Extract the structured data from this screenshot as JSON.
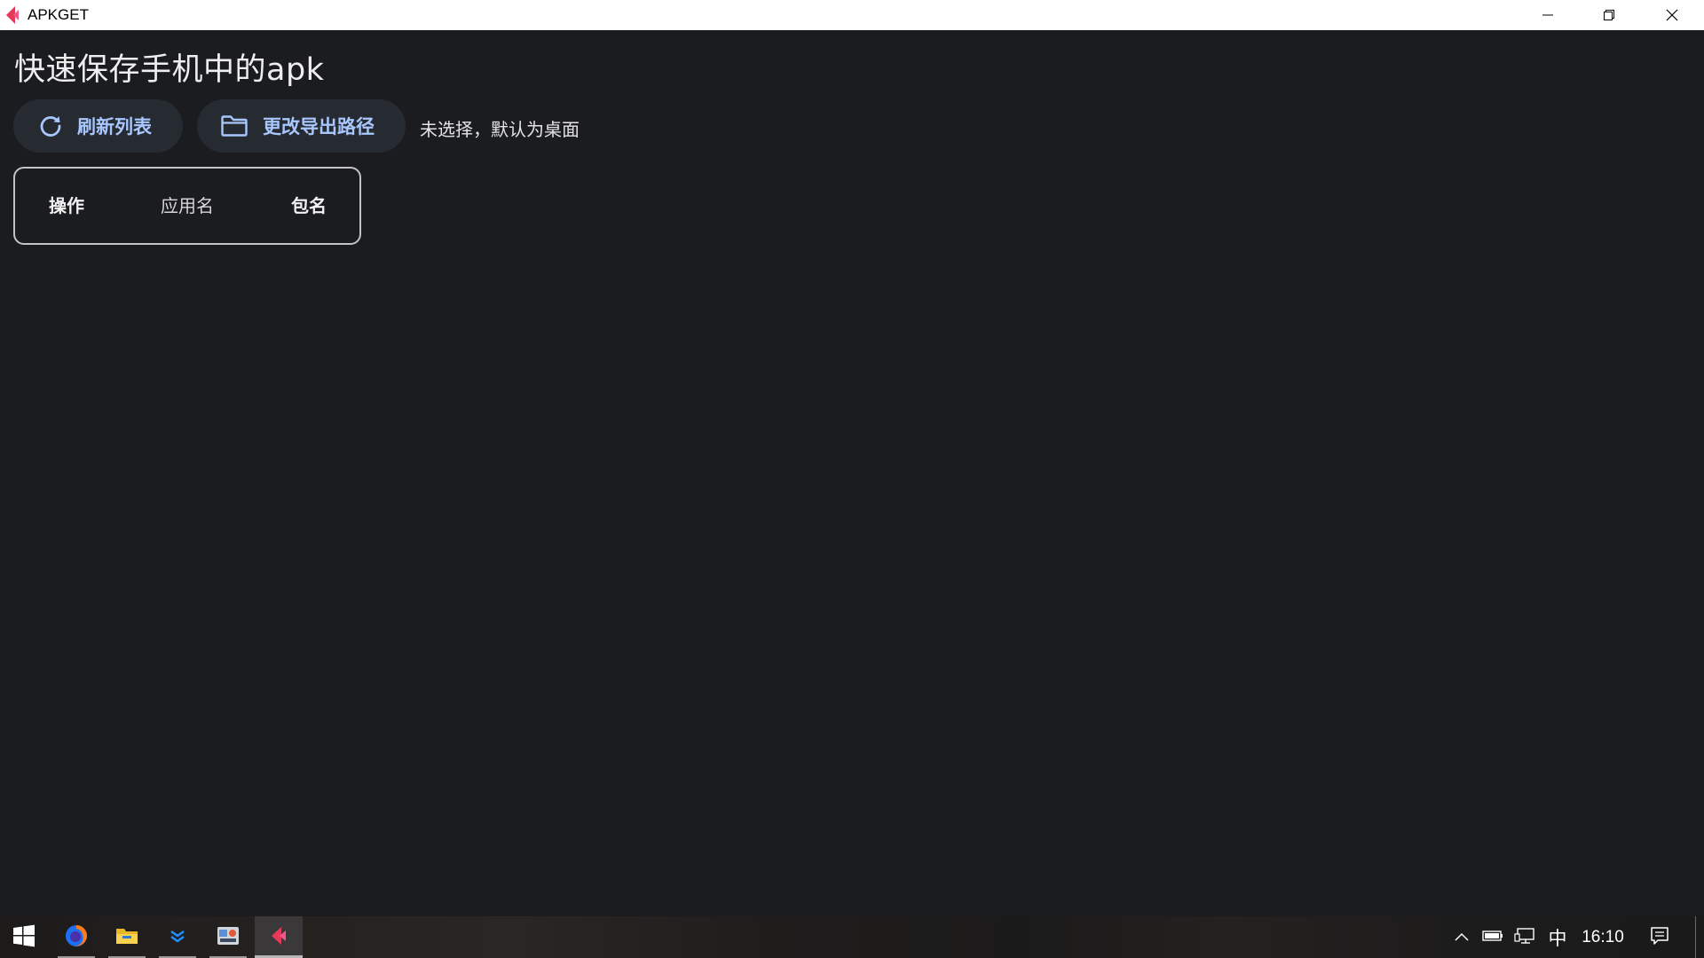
{
  "window": {
    "title": "APKGET",
    "controls": [
      "minimize-icon",
      "restore-icon",
      "close-icon"
    ]
  },
  "main": {
    "heading": "快速保存手机中的apk",
    "refresh_button": {
      "label": "刷新列表",
      "icon": "refresh-icon"
    },
    "path_button": {
      "label": "更改导出路径",
      "icon": "folder-icon"
    },
    "path_status": "未选择，默认为桌面",
    "table": {
      "columns": [
        "操作",
        "应用名",
        "包名"
      ],
      "rows": []
    }
  },
  "taskbar": {
    "start_icon": "windows-start-icon",
    "apps": [
      {
        "name": "firefox",
        "icon": "firefox-icon",
        "state": "open"
      },
      {
        "name": "file-explorer",
        "icon": "folder-icon",
        "state": "open"
      },
      {
        "name": "app-blue-chevrons",
        "icon": "chevrons-icon",
        "state": "open"
      },
      {
        "name": "app-tools",
        "icon": "tools-icon",
        "state": "open"
      },
      {
        "name": "apkget",
        "icon": "apkget-icon",
        "state": "active"
      }
    ],
    "tray": {
      "icons": [
        "chevron-up-icon",
        "battery-icon",
        "network-icon"
      ],
      "ime": "中",
      "clock": "16:10",
      "notification_icon": "notification-icon"
    }
  },
  "colors": {
    "background": "#1b1c1f",
    "button_bg": "#262a31",
    "accent": "#a9c7ff",
    "logo_red": "#e53958",
    "logo_pink": "#f2568c"
  }
}
